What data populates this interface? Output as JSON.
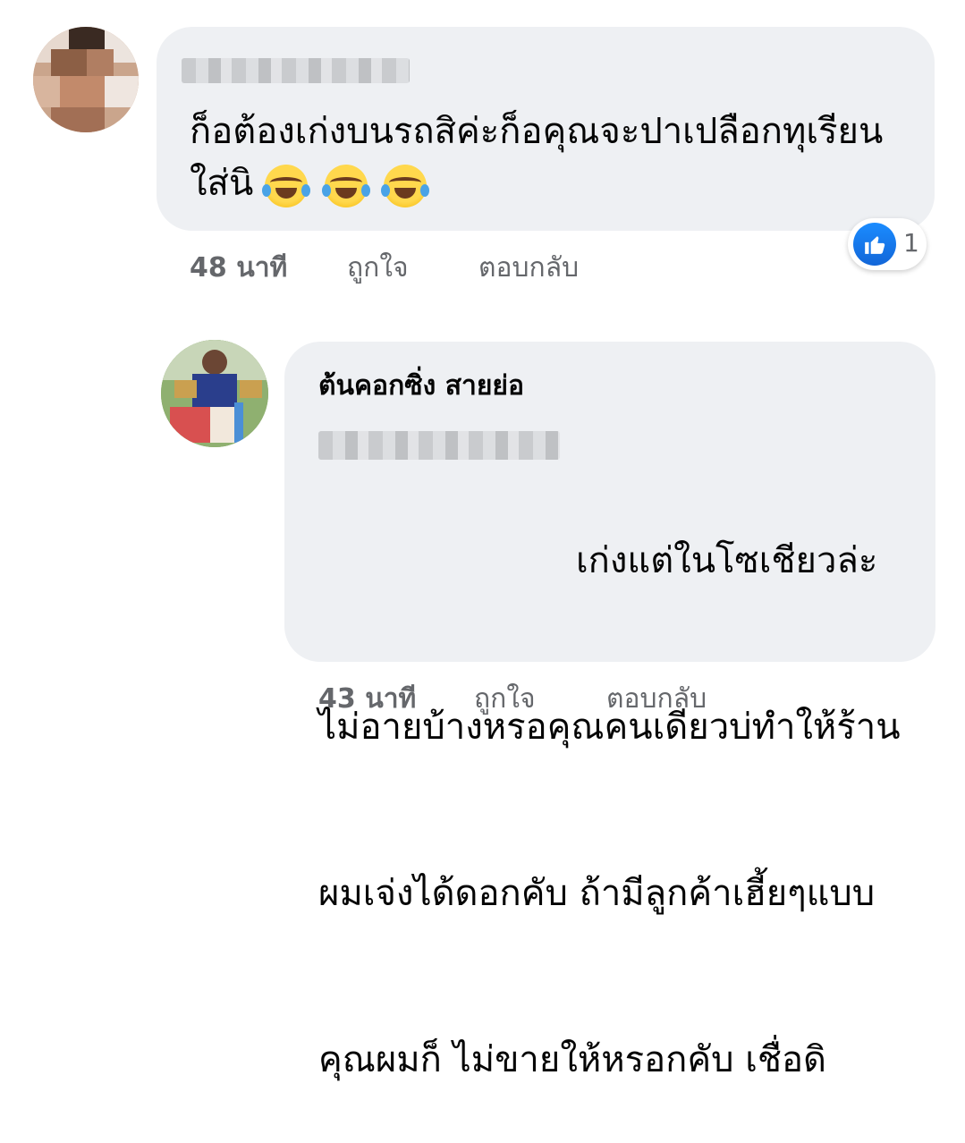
{
  "comments": [
    {
      "text_line1": "ก็อต้องเก่งบนรถสิค่ะก็อคุณจะปาเปลือกทุเรียน",
      "text_line2": "ใส่นิ",
      "emoji": [
        "rofl-emoji",
        "rofl-emoji",
        "rofl-emoji"
      ],
      "time": "48 นาที",
      "like_label": "ถูกใจ",
      "reply_label": "ตอบกลับ",
      "reaction_count": "1",
      "reaction_icon": "thumbs-up-icon"
    },
    {
      "author": "ต้นคอกซิ่ง สายย่อ",
      "text": "เก่งแต่ในโซเชียวล่ะ",
      "text_line2": "ไม่อายบ้างหรอคุณคนเดียวบ่ทำให้ร้าน",
      "text_line3": "ผมเจ่งได้ดอกคับ ถ้ามีลูกค้าเฮี้ยๆแบบ",
      "text_line4": "คุณผมก็ ไม่ขายให้หรอกคับ เชื่อดิ",
      "time": "43 นาที",
      "like_label": "ถูกใจ",
      "reply_label": "ตอบกลับ"
    }
  ],
  "colors": {
    "bubble": "#eef0f3",
    "meta": "#65676b",
    "like_blue": "#1877f2"
  }
}
